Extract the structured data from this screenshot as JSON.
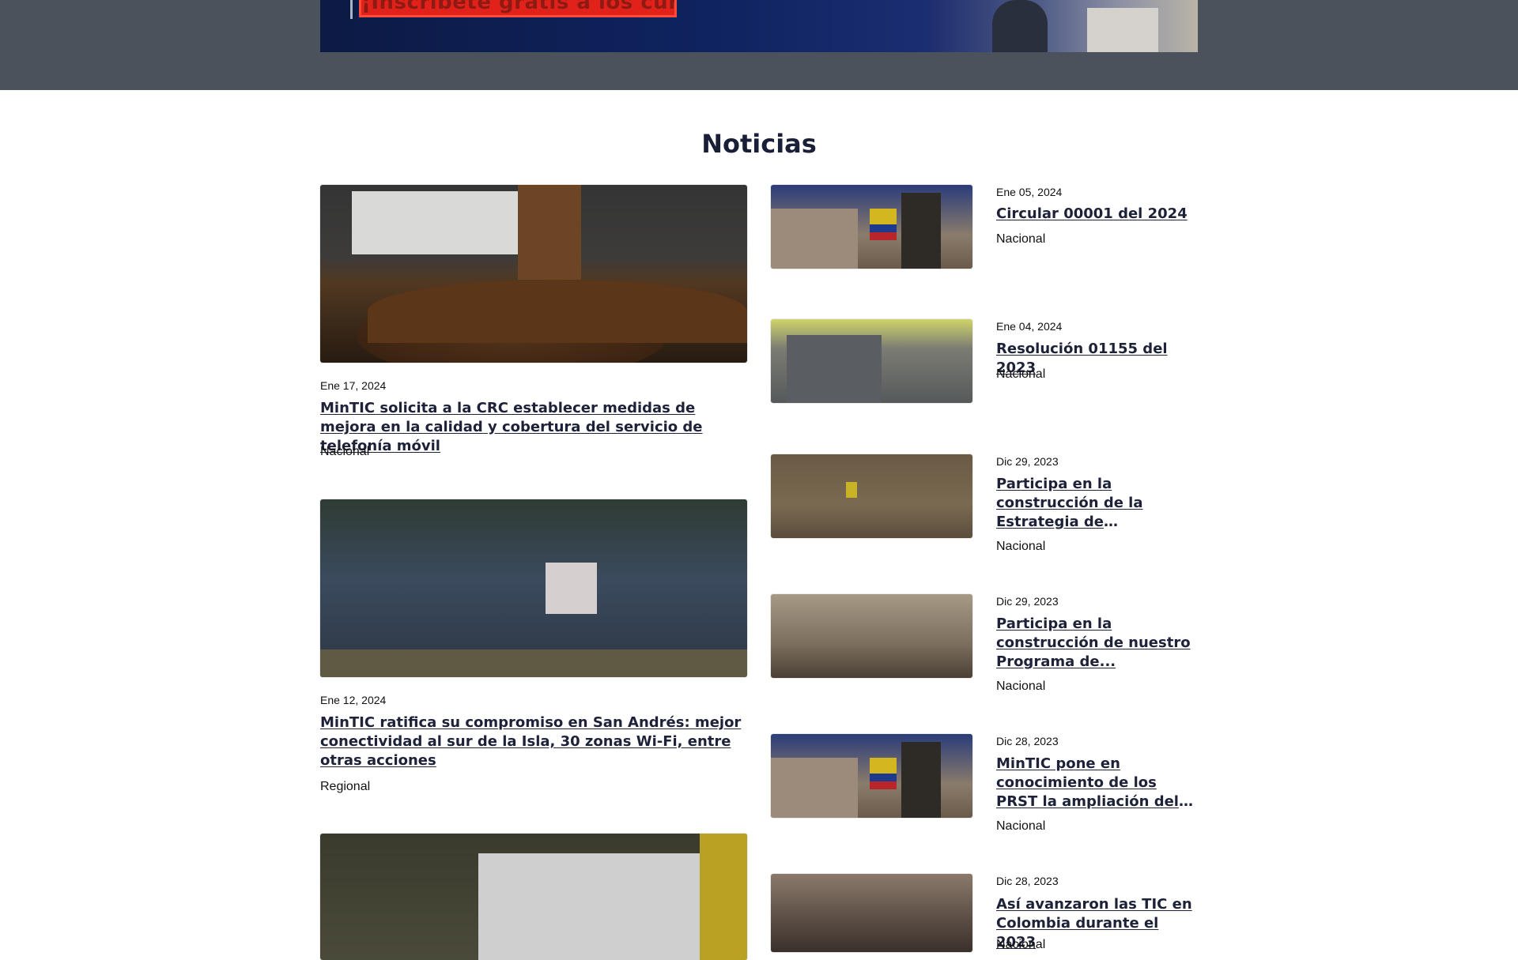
{
  "banner": {
    "cta_text": "¡Inscríbete gratis a los cursos!"
  },
  "section_title": "Noticias",
  "featured_news": [
    {
      "date": "Ene 17, 2024",
      "title": "MinTIC solicita a la CRC establecer medidas de mejora en la calidad y cobertura del servicio de telefonía móvil",
      "category": "Nacional"
    },
    {
      "date": "Ene 12, 2024",
      "title": "MinTIC ratifica su compromiso en San Andrés: mejor conectividad al sur de la Isla, 30 zonas Wi-Fi, entre otras acciones",
      "category": "Regional"
    },
    {
      "date": "",
      "title": "",
      "category": ""
    }
  ],
  "side_news": [
    {
      "date": "Ene 05, 2024",
      "title": "Circular 00001 del 2024",
      "category": "Nacional"
    },
    {
      "date": "Ene 04, 2024",
      "title": "Resolución 01155 del 2023",
      "category": "Nacional"
    },
    {
      "date": "Dic 29, 2023",
      "title": "Participa en la construcción de la Estrategia de Participació...",
      "category": "Nacional"
    },
    {
      "date": "Dic 29, 2023",
      "title": "Participa en la construcción de nuestro Programa de...",
      "category": "Nacional"
    },
    {
      "date": "Dic 28, 2023",
      "title": "MinTIC pone en conocimiento de los PRST la ampliación del término...",
      "category": "Nacional"
    },
    {
      "date": "Dic 28, 2023",
      "title": "Así avanzaron las TIC en Colombia durante el 2023",
      "category": "Nacional"
    }
  ]
}
